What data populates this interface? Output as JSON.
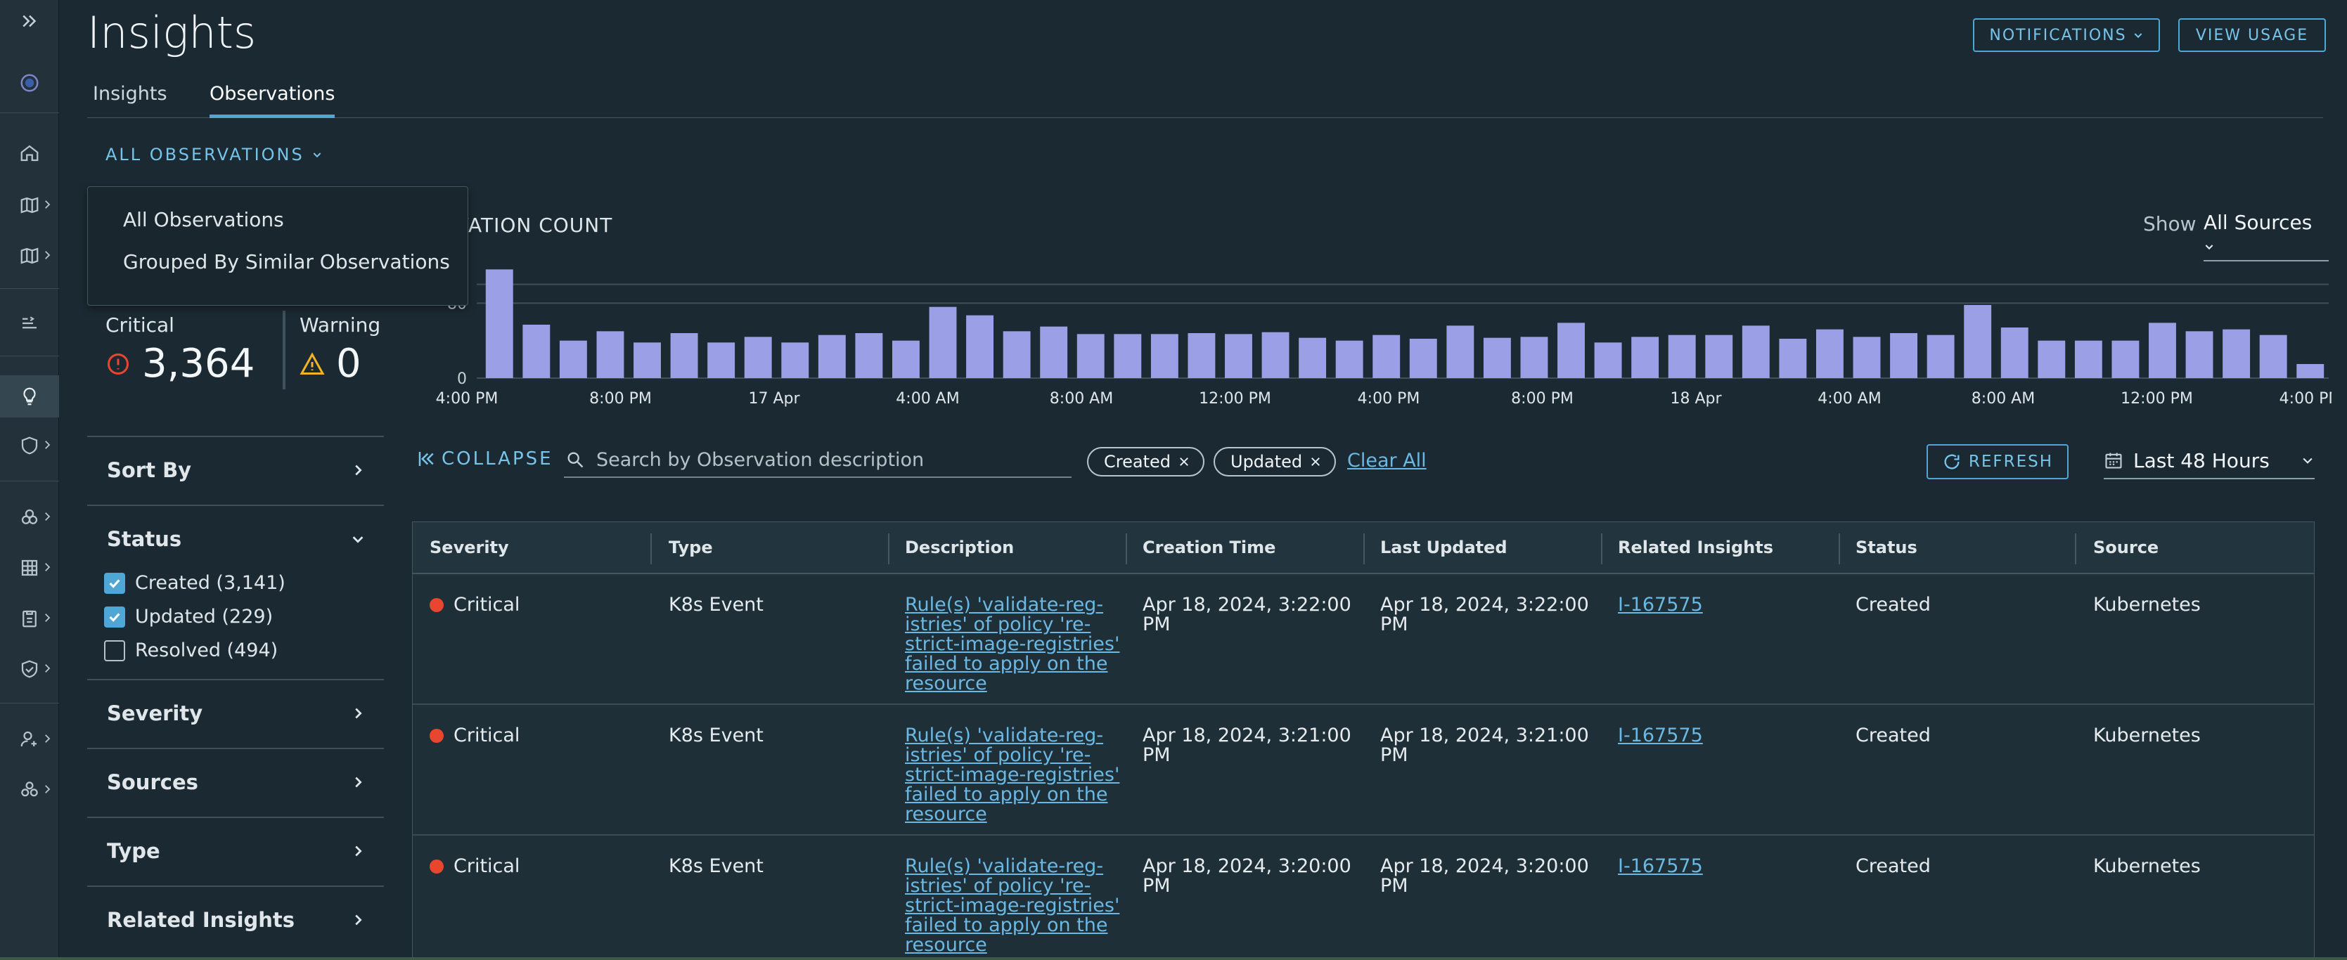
{
  "app": {
    "title": "Insights"
  },
  "header": {
    "notifications_label": "NOTIFICATIONS",
    "view_usage_label": "VIEW USAGE"
  },
  "tabs": [
    {
      "label": "Insights"
    },
    {
      "label": "Observations"
    }
  ],
  "view_select": {
    "label": "ALL OBSERVATIONS"
  },
  "dropdown": {
    "items": [
      {
        "label": "All Observations"
      },
      {
        "label": "Grouped By Similar Observations"
      }
    ]
  },
  "chart_header": {
    "title": "ERVATION COUNT",
    "show_label": "Show",
    "show_value": "All Sources"
  },
  "counts": {
    "critical": {
      "label": "Critical",
      "value": "3,364"
    },
    "warning": {
      "label": "Warning",
      "value": "0"
    }
  },
  "filters": {
    "sort_by": "Sort By",
    "status": "Status",
    "status_options": [
      {
        "label": "Created (3,141)",
        "checked": true
      },
      {
        "label": "Updated (229)",
        "checked": true
      },
      {
        "label": "Resolved (494)",
        "checked": false
      }
    ],
    "severity": "Severity",
    "sources": "Sources",
    "type": "Type",
    "related_insights": "Related Insights"
  },
  "toolbar": {
    "collapse_label": "COLLAPSE",
    "search_placeholder": "Search by Observation description",
    "chips": [
      "Created",
      "Updated"
    ],
    "clear_all": "Clear All",
    "refresh_label": "REFRESH",
    "time_range": "Last 48 Hours"
  },
  "table": {
    "columns": [
      "Severity",
      "Type",
      "Description",
      "Creation Time",
      "Last Updated",
      "Related Insights",
      "Status",
      "Source"
    ],
    "rows": [
      {
        "severity": "Critical",
        "type": "K8s Event",
        "description": [
          "Rule(s) 'validate-reg-",
          "istries' of policy 're-",
          "strict-image-registries'",
          "failed to apply on the",
          "resource"
        ],
        "creation_time": [
          "Apr 18, 2024, 3:22:00",
          "PM"
        ],
        "last_updated": [
          "Apr 18, 2024, 3:22:00",
          "PM"
        ],
        "insight": "I-167575",
        "status": "Created",
        "source": "Kubernetes"
      },
      {
        "severity": "Critical",
        "type": "K8s Event",
        "description": [
          "Rule(s) 'validate-reg-",
          "istries' of policy 're-",
          "strict-image-registries'",
          "failed to apply on the",
          "resource"
        ],
        "creation_time": [
          "Apr 18, 2024, 3:21:00",
          "PM"
        ],
        "last_updated": [
          "Apr 18, 2024, 3:21:00",
          "PM"
        ],
        "insight": "I-167575",
        "status": "Created",
        "source": "Kubernetes"
      },
      {
        "severity": "Critical",
        "type": "K8s Event",
        "description": [
          "Rule(s) 'validate-reg-",
          "istries' of policy 're-",
          "strict-image-registries'",
          "failed to apply on the",
          "resource"
        ],
        "creation_time": [
          "Apr 18, 2024, 3:20:00",
          "PM"
        ],
        "last_updated": [
          "Apr 18, 2024, 3:20:00",
          "PM"
        ],
        "insight": "I-167575",
        "status": "Created",
        "source": "Kubernetes"
      }
    ]
  },
  "chart_data": {
    "type": "bar",
    "title": "",
    "y_ticks": [
      "0",
      "80",
      "100"
    ],
    "ylim": [
      0,
      120
    ],
    "x_tick_labels": [
      "4:00 PM",
      "8:00 PM",
      "17 Apr",
      "4:00 AM",
      "8:00 AM",
      "12:00 PM",
      "4:00 PM",
      "8:00 PM",
      "18 Apr",
      "4:00 AM",
      "8:00 AM",
      "12:00 PM",
      "4:00 PM"
    ],
    "values": [
      116,
      57,
      40,
      50,
      38,
      48,
      38,
      44,
      38,
      46,
      48,
      40,
      76,
      67,
      50,
      55,
      47,
      47,
      47,
      48,
      47,
      49,
      43,
      40,
      46,
      42,
      56,
      43,
      44,
      59,
      38,
      44,
      46,
      46,
      56,
      42,
      52,
      44,
      48,
      46,
      78,
      54,
      40,
      40,
      40,
      59,
      50,
      52,
      46,
      15
    ],
    "bar_color": "#9b9fe6",
    "grid": true
  }
}
